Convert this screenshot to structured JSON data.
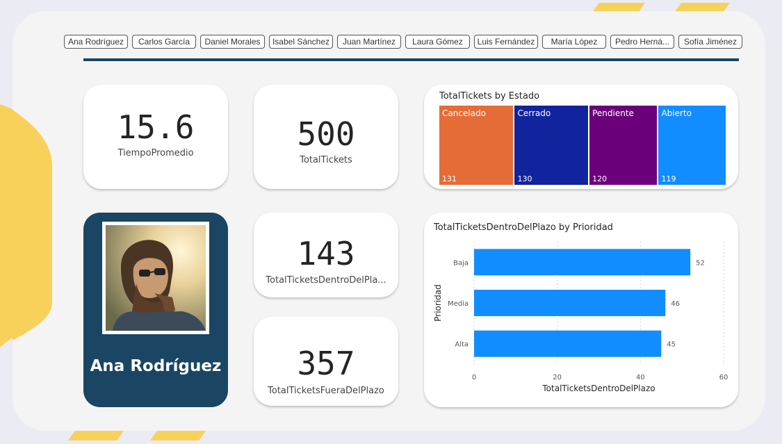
{
  "slicer": {
    "names": [
      "Ana Rodríguez",
      "Carlos García",
      "Daniel Morales",
      "Isabel Sánchez",
      "Juan Martínez",
      "Laura Gómez",
      "Luis Fernández",
      "María López",
      "Pedro Herná...",
      "Sofía Jiménez"
    ]
  },
  "kpis": {
    "tiempo_promedio": {
      "value": "15.6",
      "label": "TiempoPromedio"
    },
    "total_tickets": {
      "value": "500",
      "label": "TotalTickets"
    },
    "dentro_plazo": {
      "value": "143",
      "label": "TotalTicketsDentroDelPla..."
    },
    "fuera_plazo": {
      "value": "357",
      "label": "TotalTicketsFueraDelPlazo"
    }
  },
  "profile": {
    "name": "Ana Rodríguez"
  },
  "colors": {
    "navy": "#1a4563",
    "yellow": "#f7d15a",
    "cancelado": "#e66c37",
    "cerrado": "#12239e",
    "pendiente": "#6b007b",
    "abierto": "#118dff",
    "bar": "#118dff"
  },
  "chart_data": [
    {
      "type": "treemap",
      "title": "TotalTickets by Estado",
      "categories": [
        "Cancelado",
        "Cerrado",
        "Pendiente",
        "Abierto"
      ],
      "values": [
        131,
        130,
        120,
        119
      ]
    },
    {
      "type": "bar",
      "orientation": "horizontal",
      "title": "TotalTicketsDentroDelPlazo by Prioridad",
      "categories": [
        "Baja",
        "Media",
        "Alta"
      ],
      "values": [
        52,
        46,
        45
      ],
      "xlabel": "TotalTicketsDentroDelPlazo",
      "ylabel": "Prioridad",
      "xlim": [
        0,
        60
      ],
      "xticks": [
        0,
        20,
        40,
        60
      ],
      "grid": true
    }
  ]
}
